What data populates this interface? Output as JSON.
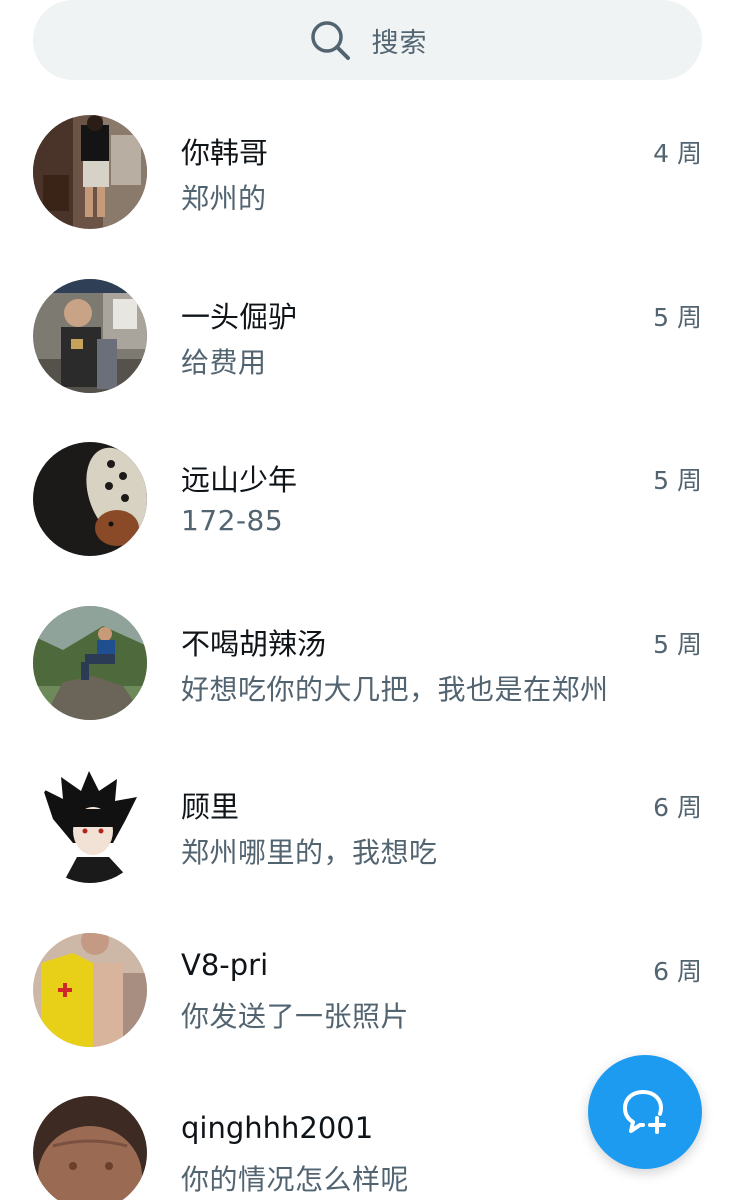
{
  "search": {
    "placeholder": "搜索",
    "icon": "search-icon"
  },
  "conversations": [
    {
      "name": "你韩哥",
      "time": "4 周",
      "preview": "郑州的",
      "avatar": "avatar-photo"
    },
    {
      "name": "一头倔驴",
      "time": "5 周",
      "preview": "给费用",
      "avatar": "avatar-photo"
    },
    {
      "name": "远山少年",
      "time": "5 周",
      "preview": "172-85",
      "avatar": "avatar-photo"
    },
    {
      "name": "不喝胡辣汤",
      "time": "5 周",
      "preview": "好想吃你的大几把，我也是在郑州",
      "avatar": "avatar-photo"
    },
    {
      "name": "顾里",
      "time": "6 周",
      "preview": "郑州哪里的，我想吃",
      "avatar": "avatar-illustration"
    },
    {
      "name": "V8-pri",
      "time": "6 周",
      "preview": "你发送了一张照片",
      "avatar": "avatar-photo"
    },
    {
      "name": "qinghhh2001",
      "time": "",
      "preview": "你的情况怎么样呢",
      "avatar": "avatar-photo"
    }
  ],
  "fab": {
    "icon": "new-message-icon"
  },
  "colors": {
    "accent": "#1d9bf0",
    "primary_text": "#0f1419",
    "secondary_text": "#536471",
    "search_bg": "#eff3f4"
  }
}
